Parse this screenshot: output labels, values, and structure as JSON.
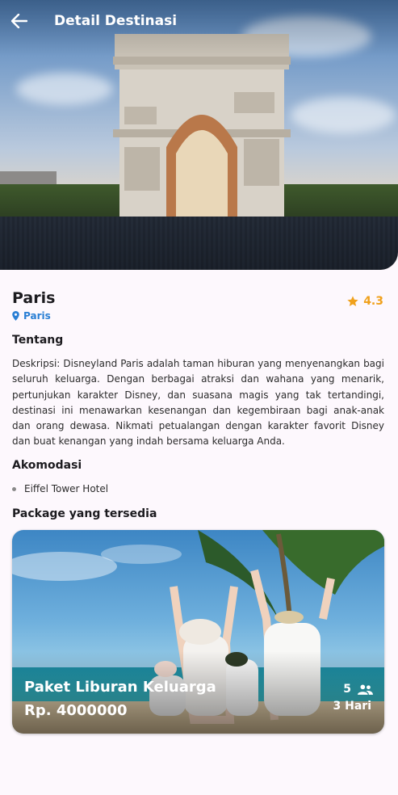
{
  "header": {
    "title": "Detail Destinasi",
    "back_icon": "arrow-back-icon"
  },
  "destination": {
    "name": "Paris",
    "location": "Paris",
    "location_icon": "location-pin-icon",
    "rating": "4.3",
    "rating_icon": "star-icon",
    "rating_color": "#f0a11c",
    "location_color": "#2a7fd4"
  },
  "about": {
    "title": "Tentang",
    "description": "Deskripsi: Disneyland Paris adalah taman hiburan yang menyenangkan bagi seluruh keluarga. Dengan berbagai atraksi dan wahana yang menarik, pertunjukan karakter Disney, dan suasana magis yang tak tertandingi, destinasi ini menawarkan kesenangan dan kegembiraan bagi anak-anak dan orang dewasa. Nikmati petualangan dengan karakter favorit Disney dan buat kenangan yang indah bersama keluarga Anda."
  },
  "accommodation": {
    "title": "Akomodasi",
    "items": [
      "Eiffel Tower Hotel"
    ]
  },
  "packages": {
    "title": "Package yang tersedia",
    "items": [
      {
        "name": "Paket Liburan Keluarga",
        "price": "Rp. 4000000",
        "people": "5",
        "people_icon": "group-icon",
        "duration": "3 Hari"
      }
    ]
  }
}
